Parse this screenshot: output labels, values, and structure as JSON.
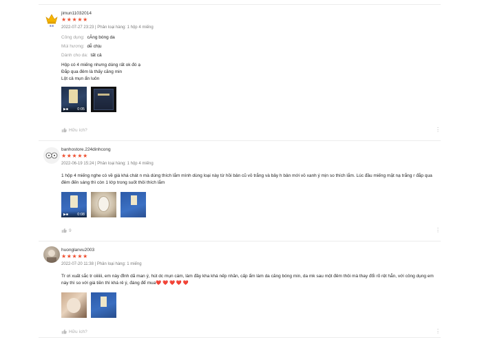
{
  "reviews": [
    {
      "username": "jimun11032014",
      "stars": "★★★★★",
      "meta": "2022-07-27 23:23 | Phân loại hàng: 1 hộp 4 miếng",
      "attributes": [
        {
          "label": "Công dụng:",
          "value": "cĂng bóng da"
        },
        {
          "label": "Mùi hương:",
          "value": "dễ chịu"
        },
        {
          "label": "Dành cho da:",
          "value": "tất cả"
        }
      ],
      "comment_lines": [
        "Hộp có 4 miếng nhưng dùng rất ok đó ạ",
        "Đắp qua đêm là thấy căng min",
        "Lột cả mụn ẩn luôn"
      ],
      "media": [
        {
          "type": "video",
          "duration": "0:05",
          "video_icon": "▶■"
        },
        {
          "type": "image"
        }
      ],
      "like_label": "Hữu ích?",
      "like_icon": "thumbs-up-icon",
      "more_icon": "⋮"
    },
    {
      "username": "banhostore.224dinhcong",
      "stars": "★★★★★",
      "meta": "2022-06-19 15:24 | Phân loại hàng: 1 hộp 4 miếng",
      "comment_lines": [
        "1 hộp 4 miếng nghe có về giá khá chát n mà dùng thích lắm mình dùng loại này từ hồi bản cũ vỏ trắng và bây h bản mới vỏ xanh ý mịn so thích lắm. Lúc đầu miếng mặt nạ trắng r đắp qua đêm đến sáng thì còn 1 lớp trong suốt thôi thích lắm"
      ],
      "media": [
        {
          "type": "video",
          "duration": "0:08",
          "video_icon": "▶■"
        },
        {
          "type": "image"
        },
        {
          "type": "image"
        }
      ],
      "like_label": "9",
      "like_icon": "thumbs-up-icon",
      "more_icon": "⋮"
    },
    {
      "username": "huonglanvu2003",
      "stars": "★★★★★",
      "meta": "2022-07-20 11:38 | Phân loại hàng: 1 miếng",
      "comment_lines": [
        "Tr ơi xuất sắc tr oiiiiii, em này đỉnh dã man ý, hút dc mụn cám, làm đầy kha khá nếp nhăn, cấp ẩm làm da căng bóng min, da mk sau một đêm thôi mà thay đổi rõ rệt hẳn, với công dụng em này thì so với giá tiền thì khá rẻ ý, đáng để mua❤️ ❤️ ❤️ ❤️ ❤️"
      ],
      "media": [
        {
          "type": "image"
        },
        {
          "type": "image"
        }
      ],
      "like_label": "Hữu ích?",
      "like_icon": "thumbs-up-icon",
      "more_icon": "⋮"
    }
  ],
  "colors": {
    "star": "#ee4d2d",
    "muted": "#9e9e9e",
    "divider": "#ececec"
  }
}
